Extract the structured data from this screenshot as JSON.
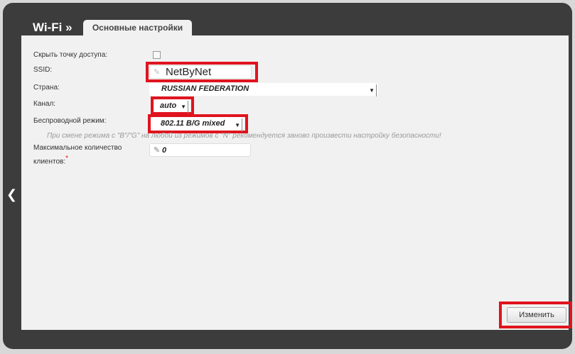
{
  "header": {
    "breadcrumb": "Wi-Fi »",
    "tab": "Основные настройки"
  },
  "form": {
    "hide_ap_label": "Скрыть точку доступа:",
    "ssid_label": "SSID:",
    "ssid_value": "NetByNet",
    "country_label": "Страна:",
    "country_value": "RUSSIAN FEDERATION",
    "channel_label": "Канал:",
    "channel_value": "auto",
    "mode_label": "Беспроводной режим:",
    "mode_value": "802.11 B/G mixed",
    "hint": "При смене режима с \"B\"/\"G\" на любой из режимов с \"N\" рекомендуется заново произвести настройку безопасности!",
    "max_clients_label_1": "Максимальное количество",
    "max_clients_label_2": "клиентов:",
    "required_mark": "*",
    "max_clients_value": "0"
  },
  "actions": {
    "apply": "Изменить"
  },
  "highlight_color": "#e0141e"
}
